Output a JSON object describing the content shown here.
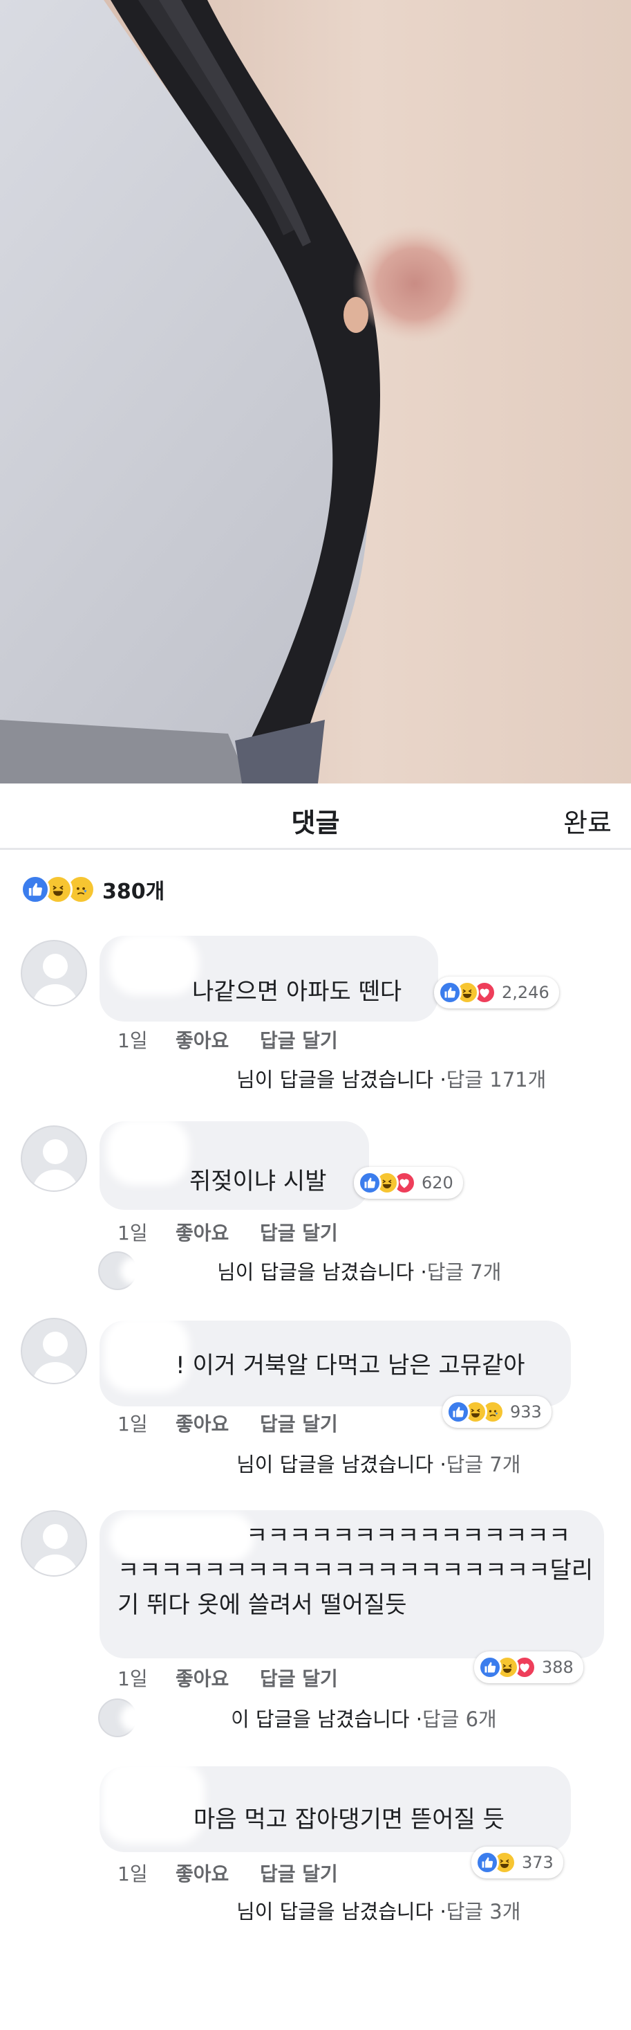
{
  "header": {
    "title": "댓글",
    "done_label": "완료"
  },
  "summary": {
    "reactions": [
      "like-icon",
      "haha-icon",
      "sad-icon"
    ],
    "count": "380개"
  },
  "colors": {
    "like": "#3b7ded",
    "haha": "#f7c531",
    "love": "#ee3e5a",
    "bubble": "#f0f1f4",
    "meta": "#65676b"
  },
  "comments": [
    {
      "text": "나같으면 아파도 뗀다",
      "reactions": [
        "like-icon",
        "haha-icon",
        "love-icon"
      ],
      "reaction_count": "2,246",
      "time": "1일",
      "like": "좋아요",
      "reply": "답글 달기",
      "replies_text": "님이 답글을 남겼습니다 · ",
      "replies_count": "답글 171개"
    },
    {
      "text": "쥐젖이냐 시발",
      "reactions": [
        "like-icon",
        "haha-icon",
        "love-icon"
      ],
      "reaction_count": "620",
      "time": "1일",
      "like": "좋아요",
      "reply": "답글 달기",
      "replies_text": "님이 답글을 남겼습니다 · ",
      "replies_count": "답글 7개"
    },
    {
      "text": "! 이거 거북알 다먹고 남은 고뮤같아",
      "reactions": [
        "like-icon",
        "haha-icon",
        "sad-icon"
      ],
      "reaction_count": "933",
      "time": "1일",
      "like": "좋아요",
      "reply": "답글 달기",
      "replies_text": "님이 답글을 남겼습니다 · ",
      "replies_count": "답글 7개"
    },
    {
      "text_line1": "ㅋㅋㅋㅋㅋㅋㅋㅋㅋㅋㅋㅋㅋㅋㅋ",
      "text_line2": "ㅋㅋㅋㅋㅋㅋㅋㅋㅋㅋㅋㅋㅋㅋㅋㅋㅋㅋㅋㅋ달리",
      "text_line3": "기 뛰다 옷에 쓸려서 떨어질듯",
      "reactions": [
        "like-icon",
        "haha-icon",
        "love-icon"
      ],
      "reaction_count": "388",
      "time": "1일",
      "like": "좋아요",
      "reply": "답글 달기",
      "replies_text": "이 답글을 남겼습니다 · ",
      "replies_count": "답글 6개"
    },
    {
      "text": "마음 먹고 잡아댕기면 뜯어질 듯",
      "reactions": [
        "like-icon",
        "haha-icon"
      ],
      "reaction_count": "373",
      "time": "1일",
      "like": "좋아요",
      "reply": "답글 달기",
      "replies_text": "님이 답글을 남겼습니다 · ",
      "replies_count": "답글 3개"
    }
  ]
}
